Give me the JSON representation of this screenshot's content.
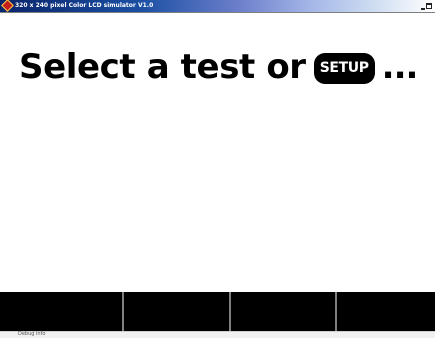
{
  "window": {
    "title": "320 x 240 pixel Color LCD simulator V1.0",
    "icon": "app-icon",
    "controls": [
      "minimize-icon",
      "maximize-icon"
    ]
  },
  "lcd": {
    "prompt_before": "Select a test or",
    "setup_label": "SETUP",
    "prompt_after": "...",
    "softkeys": [
      {
        "label": ""
      },
      {
        "label": ""
      },
      {
        "label": ""
      },
      {
        "label": ""
      }
    ]
  },
  "statusbar": {
    "text": "Debug info"
  },
  "colors": {
    "lcd_background": "#ffffff",
    "text": "#000000",
    "softkey_background": "#000000",
    "divider": "#7f7f7f",
    "title_gradient_start": "#0a246a"
  }
}
